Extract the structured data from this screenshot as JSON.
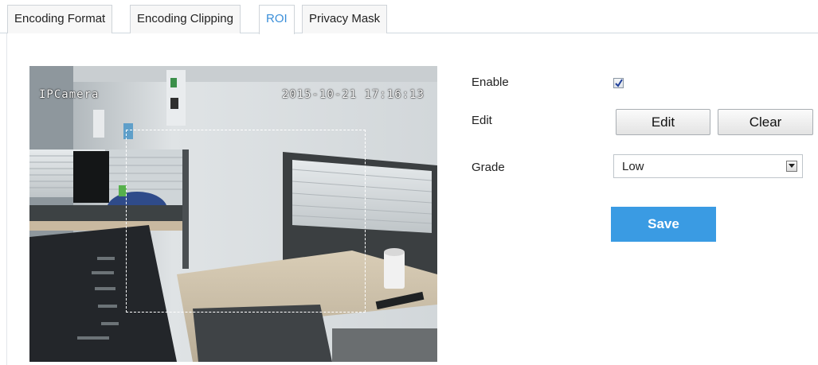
{
  "tabs": [
    {
      "label": "Encoding Format",
      "active": false
    },
    {
      "label": "Encoding Clipping",
      "active": false
    },
    {
      "label": "ROI",
      "active": true
    },
    {
      "label": "Privacy Mask",
      "active": false
    }
  ],
  "video": {
    "osd_camera_name": "IPCamera",
    "osd_timestamp": "2015-10-21 17:16:13"
  },
  "form": {
    "enable_label": "Enable",
    "enable_checked": true,
    "edit_label": "Edit",
    "edit_button": "Edit",
    "clear_button": "Clear",
    "grade_label": "Grade",
    "grade_value": "Low",
    "save_button": "Save"
  },
  "colors": {
    "accent": "#3a9be3",
    "active_tab_text": "#3b8fd9"
  }
}
